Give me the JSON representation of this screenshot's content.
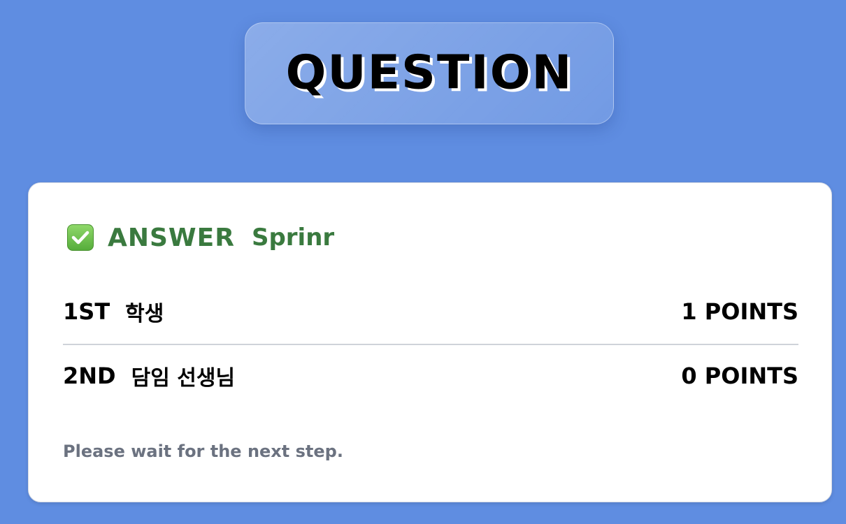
{
  "title": "QUESTION",
  "answer": {
    "icon": "check-box-icon",
    "label": "ANSWER",
    "value": "Sprinr"
  },
  "scores": [
    {
      "rank": "1ST",
      "name": "학생",
      "points": "1 POINTS"
    },
    {
      "rank": "2ND",
      "name": "담임 선생님",
      "points": "0 POINTS"
    }
  ],
  "footer": "Please wait for the next step.",
  "colors": {
    "background": "#5f8de1",
    "accent_green": "#3a7a3f",
    "muted_text": "#6b7280"
  }
}
